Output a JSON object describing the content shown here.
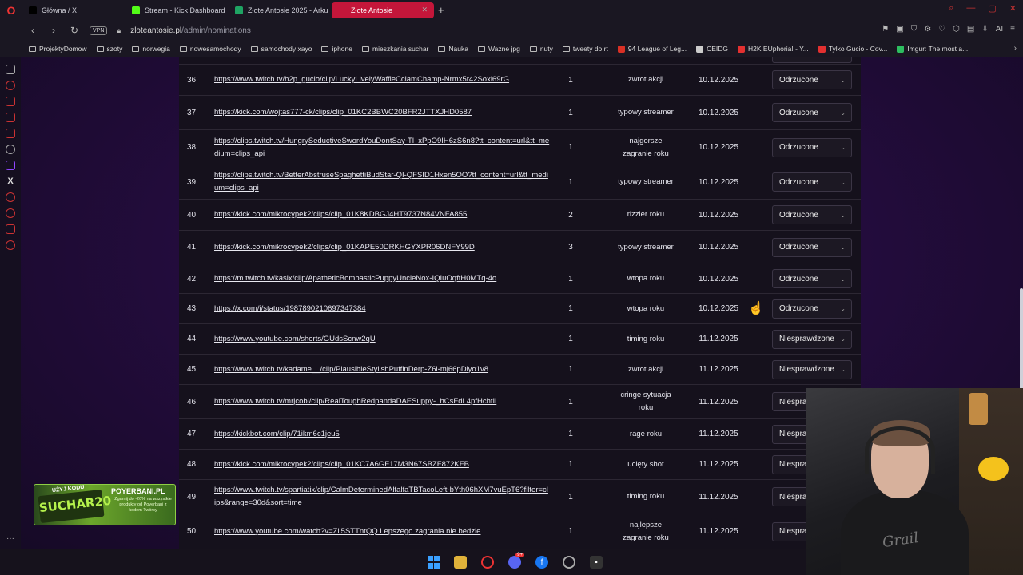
{
  "browser": {
    "tabs": [
      {
        "label": "Główna / X",
        "icon": "x-icon",
        "color": "#000000",
        "active": false
      },
      {
        "label": "Stream - Kick Dashboard",
        "icon": "kick-icon",
        "color": "#53fc18",
        "active": false
      },
      {
        "label": "Złote Antosie 2025 - Arku",
        "icon": "sheets-icon",
        "color": "#1fa463",
        "active": false
      },
      {
        "label": "Złote Antosie",
        "icon": "site-icon",
        "color": "#c4163a",
        "active": true
      }
    ],
    "new_tab": "+",
    "vpn_label": "VPN",
    "url_host": "zloteantosie.pl",
    "url_path": "/admin/nominations",
    "bookmarks": [
      {
        "label": "ProjektyDomow",
        "type": "folder"
      },
      {
        "label": "szoty",
        "type": "folder"
      },
      {
        "label": "norwegia",
        "type": "folder"
      },
      {
        "label": "nowesamochody",
        "type": "folder"
      },
      {
        "label": "samochody xayo",
        "type": "folder"
      },
      {
        "label": "iphone",
        "type": "folder"
      },
      {
        "label": "mieszkania suchar",
        "type": "folder"
      },
      {
        "label": "Nauka",
        "type": "folder"
      },
      {
        "label": "Ważne jpg",
        "type": "folder"
      },
      {
        "label": "nuty",
        "type": "folder"
      },
      {
        "label": "tweety do rt",
        "type": "folder"
      },
      {
        "label": "94 League of Leg...",
        "type": "site",
        "color": "#d93025"
      },
      {
        "label": "CEIDG",
        "type": "site",
        "color": "#cccccc"
      },
      {
        "label": "H2K EUphoria! - Y...",
        "type": "site",
        "color": "#e33030"
      },
      {
        "label": "Tylko Gucio - Cov...",
        "type": "site",
        "color": "#e33030"
      },
      {
        "label": "Imgur: The most a...",
        "type": "site",
        "color": "#2dbe60"
      }
    ],
    "addr_ai": "AI"
  },
  "nominations": {
    "rows": [
      {
        "num": "36",
        "link": "https://www.twitch.tv/h2p_gucio/clip/LuckyLivelyWaffleCclamChamp-Nrmx5r42Soxi69rG",
        "count": "1",
        "category": "zwrot akcji",
        "date": "10.12.2025",
        "status": "Odrzucone"
      },
      {
        "num": "37",
        "link": "https://kick.com/wojtas777-ck/clips/clip_01KC2BBWC20BFR2JTTXJHD0587",
        "count": "1",
        "category": "typowy streamer",
        "date": "10.12.2025",
        "status": "Odrzucone"
      },
      {
        "num": "38",
        "link": "https://clips.twitch.tv/HungrySeductiveSwordYouDontSay-Tl_xPpO9IH6zS6n8?tt_content=url&tt_medium=clips_api",
        "count": "1",
        "category": "najgorsze zagranie roku",
        "date": "10.12.2025",
        "status": "Odrzucone"
      },
      {
        "num": "39",
        "link": "https://clips.twitch.tv/BetterAbstruseSpaghettiBudStar-QI-QFSID1Hxen5OO?tt_content=url&tt_medium=clips_api",
        "count": "1",
        "category": "typowy streamer",
        "date": "10.12.2025",
        "status": "Odrzucone"
      },
      {
        "num": "40",
        "link": "https://kick.com/mikrocypek2/clips/clip_01K8KDBGJ4HT9737N84VNFA855",
        "count": "2",
        "category": "rizzler roku",
        "date": "10.12.2025",
        "status": "Odrzucone"
      },
      {
        "num": "41",
        "link": "https://kick.com/mikrocypek2/clips/clip_01KAPE50DRKHGYXPR06DNFY99D",
        "count": "3",
        "category": "typowy streamer",
        "date": "10.12.2025",
        "status": "Odrzucone"
      },
      {
        "num": "42",
        "link": "https://m.twitch.tv/kasix/clip/ApatheticBombasticPuppyUncleNox-IQIuOqftH0MTq-4o",
        "count": "1",
        "category": "wtopa roku",
        "date": "10.12.2025",
        "status": "Odrzucone"
      },
      {
        "num": "43",
        "link": "https://x.com/i/status/1987890210697347384",
        "count": "1",
        "category": "wtopa roku",
        "date": "10.12.2025",
        "status": "Odrzucone"
      },
      {
        "num": "44",
        "link": "https://www.youtube.com/shorts/GUdsScnw2qU",
        "count": "1",
        "category": "timing roku",
        "date": "11.12.2025",
        "status": "Niesprawdzone"
      },
      {
        "num": "45",
        "link": "https://www.twitch.tv/kadame__/clip/PlausibleStylishPuffinDerp-Z6i-mj66pDiyo1v8",
        "count": "1",
        "category": "zwrot akcji",
        "date": "11.12.2025",
        "status": "Niesprawdzone"
      },
      {
        "num": "46",
        "link": "https://www.twitch.tv/mrjcobi/clip/RealToughRedpandaDAESuppy-_hCsFdL4pfHchtIl",
        "count": "1",
        "category": "cringe sytuacja roku",
        "date": "11.12.2025",
        "status": "Niesprawdzone"
      },
      {
        "num": "47",
        "link": "https://kickbot.com/clip/71ikm6c1jeu5",
        "count": "1",
        "category": "rage roku",
        "date": "11.12.2025",
        "status": "Niesprawdzone"
      },
      {
        "num": "48",
        "link": "https://kick.com/mikrocypek2/clips/clip_01KC7A6GF17M3N67SBZF872KFB",
        "count": "1",
        "category": "ucięty shot",
        "date": "11.12.2025",
        "status": "Niesprawdzone"
      },
      {
        "num": "49",
        "link": "https://www.twitch.tv/spartiatix/clip/CalmDeterminedAlfalfaTBTacoLeft-bYth06hXM7vuEpT6?filter=clips&range=30d&sort=time",
        "count": "1",
        "category": "timing roku",
        "date": "11.12.2025",
        "status": "Niesprawdzone"
      },
      {
        "num": "50",
        "link": "https://www.youtube.com/watch?v=Zii5STTntQQ Lepszego zagrania nie bedzie",
        "count": "1",
        "category": "najlepsze zagranie roku",
        "date": "11.12.2025",
        "status": "Niesprawdzone"
      }
    ]
  },
  "ad": {
    "code_top": "UŻYJ KODU",
    "code": "SUCHAR20",
    "brand": "POYERBANI.PL",
    "text": "Zgarnij do -20% na wszystkie produkty od Poyerbani z kodem Twórcy"
  },
  "webcam": {
    "shirt_text": "Grail"
  },
  "taskbar": {
    "discord_badge": "9+"
  },
  "colors": {
    "accent": "#c4163a",
    "table_bg": "#15111c",
    "page_bg": "#250c40"
  }
}
